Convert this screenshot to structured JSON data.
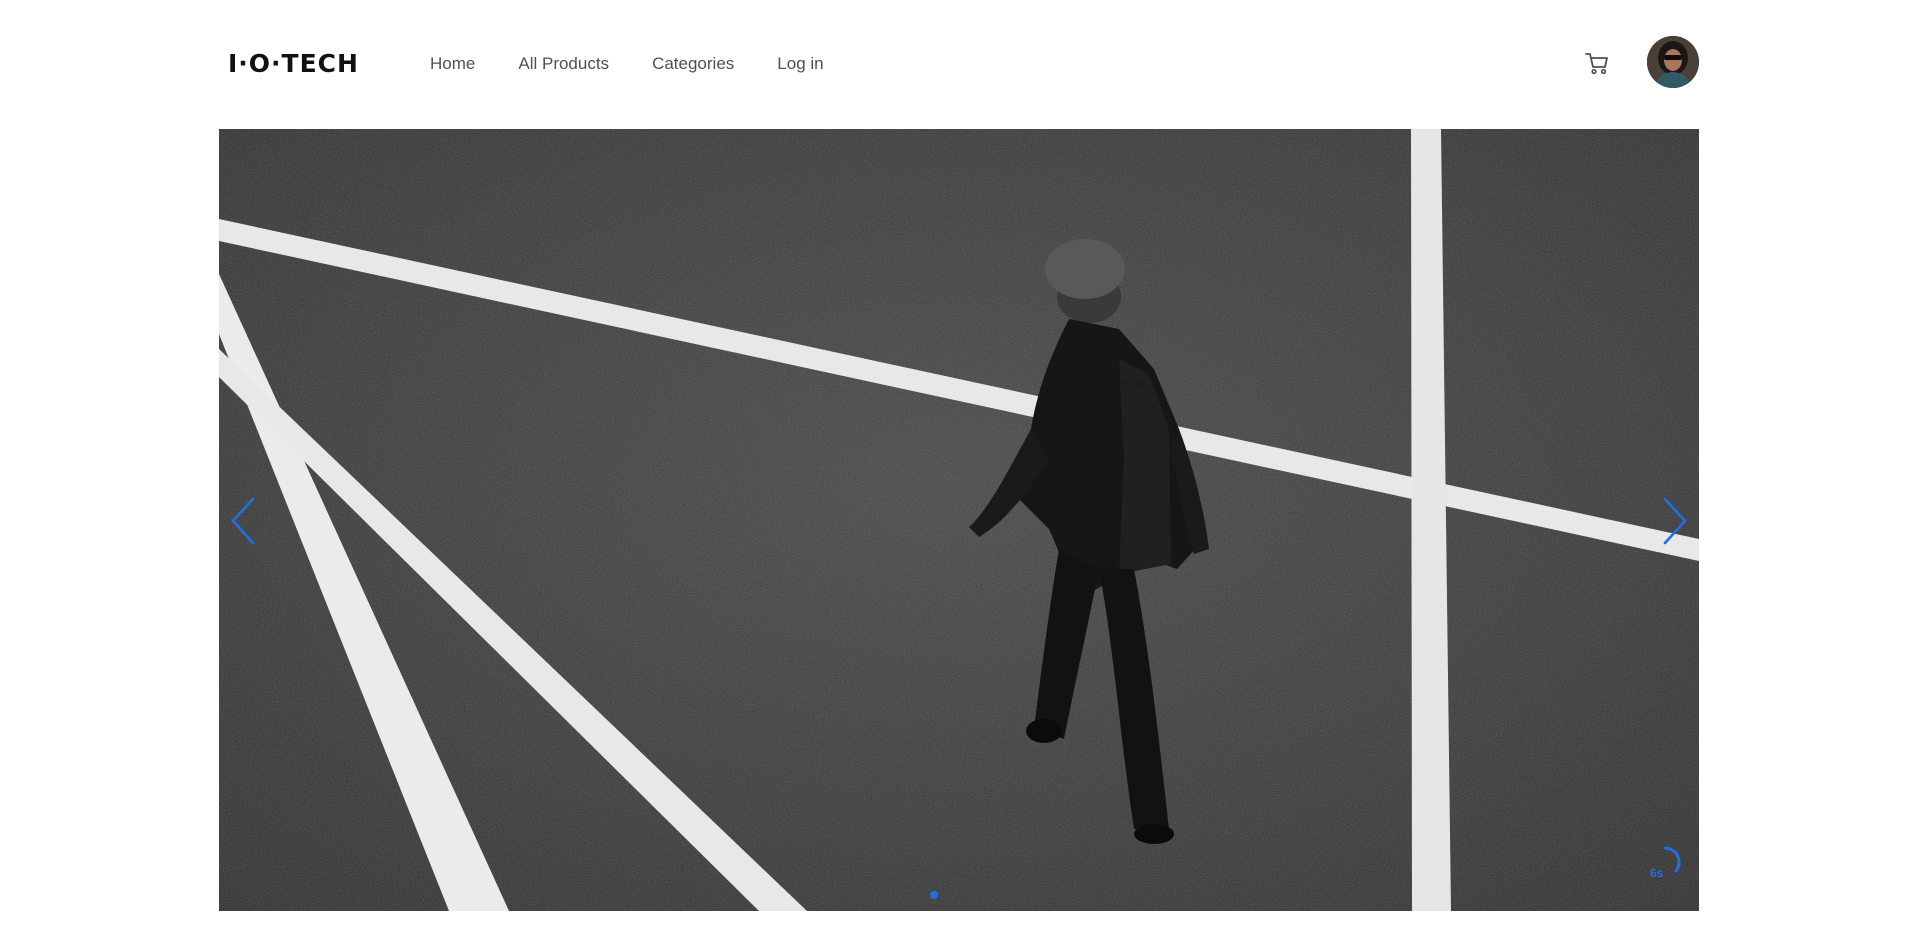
{
  "header": {
    "logo_text": "I·O·TECH",
    "nav": [
      {
        "label": "Home"
      },
      {
        "label": "All Products"
      },
      {
        "label": "Categories"
      },
      {
        "label": "Log in"
      }
    ],
    "cart_icon": "shopping-cart-icon",
    "avatar_icon": "user-avatar"
  },
  "hero": {
    "image_subject": "black-and-white photo of a person walking on asphalt with white painted lines",
    "prev_icon": "chevron-left-icon",
    "next_icon": "chevron-right-icon",
    "slide_count": 1,
    "active_slide": 1,
    "timer_label": "6s",
    "accent_color": "#1f6fe5"
  }
}
